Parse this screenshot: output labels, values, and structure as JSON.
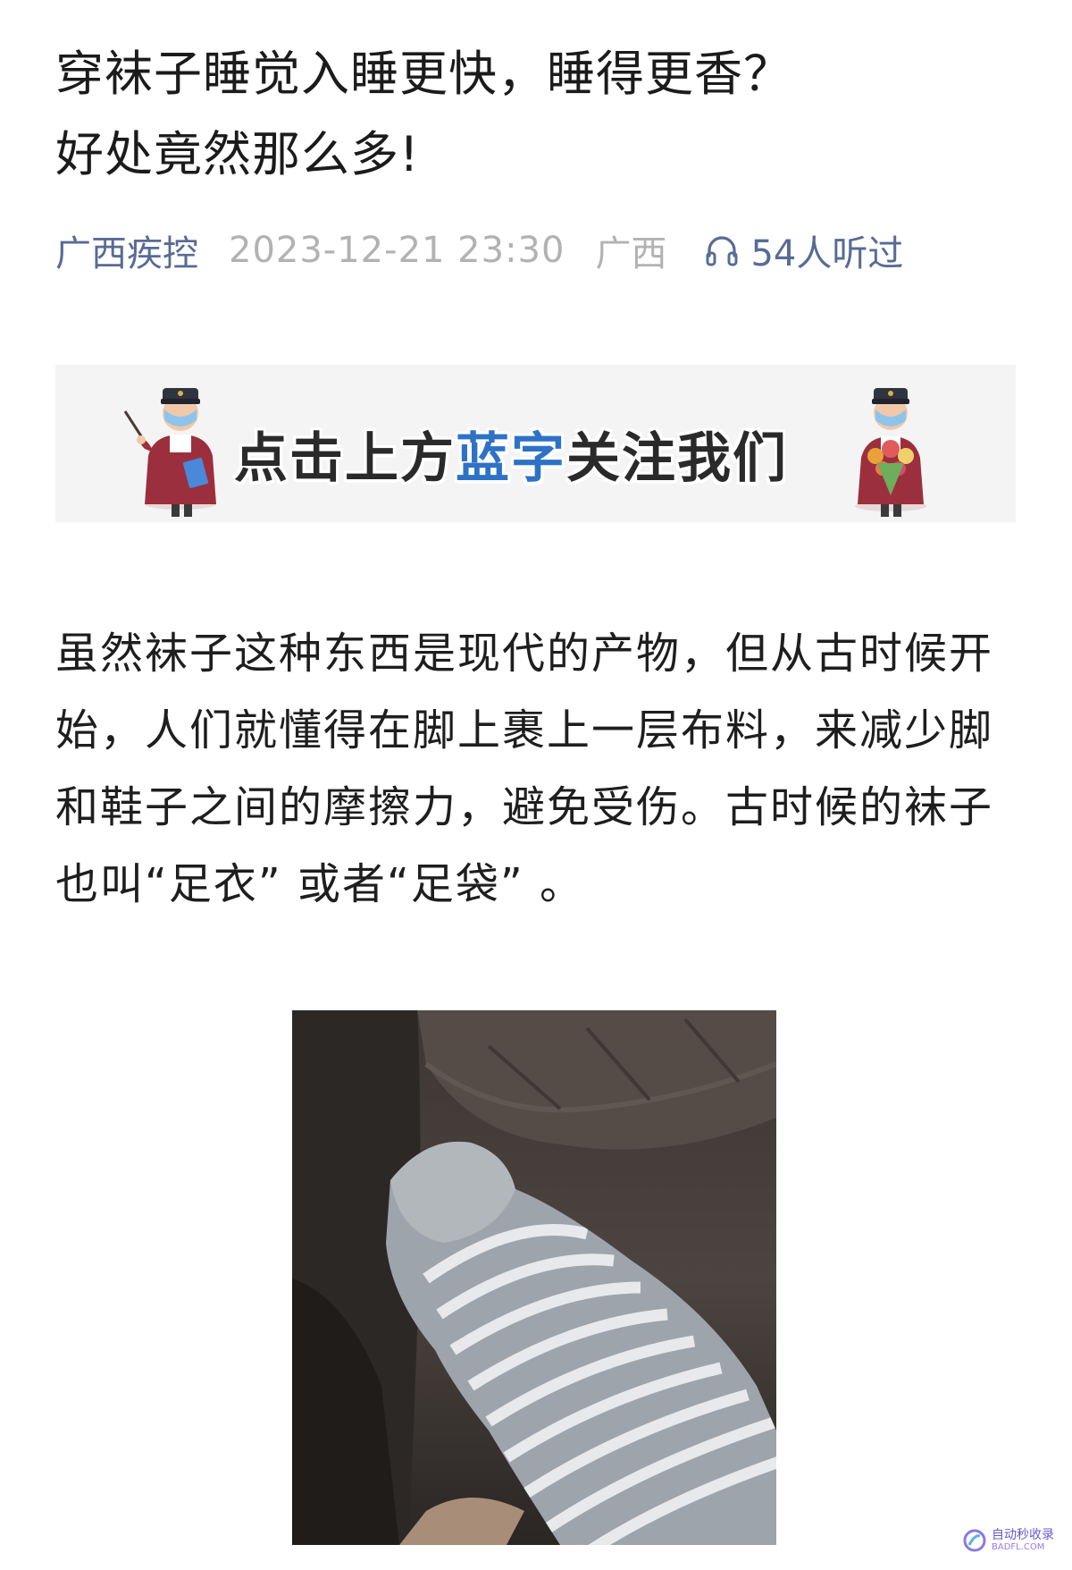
{
  "article": {
    "title_line1": "穿袜子睡觉入睡更快，睡得更香？",
    "title_line2": "好处竟然那么多!",
    "account_name": "广西疾控",
    "publish_time": "2023-12-21 23:30",
    "region": "广西",
    "listen_count": "54人听过",
    "listen_icon": "headphones-icon"
  },
  "follow_banner": {
    "text_before": "点击上方",
    "text_highlight": "蓝字",
    "text_after": "关注我们",
    "highlight_color": "#2e72c6"
  },
  "content": {
    "paragraph1": "虽然袜子这种东西是现代的产物，但从古时候开始，人们就懂得在脚上裹上一层布料，来减少脚和鞋子之间的摩擦力，避免受伤。古时候的袜子也叫“足衣” 或者“足袋” 。"
  },
  "watermark": {
    "cn": "自动秒收录",
    "en": "BADFL.COM"
  },
  "colors": {
    "link_blue": "#576b95",
    "meta_gray": "#b2b2b2"
  }
}
